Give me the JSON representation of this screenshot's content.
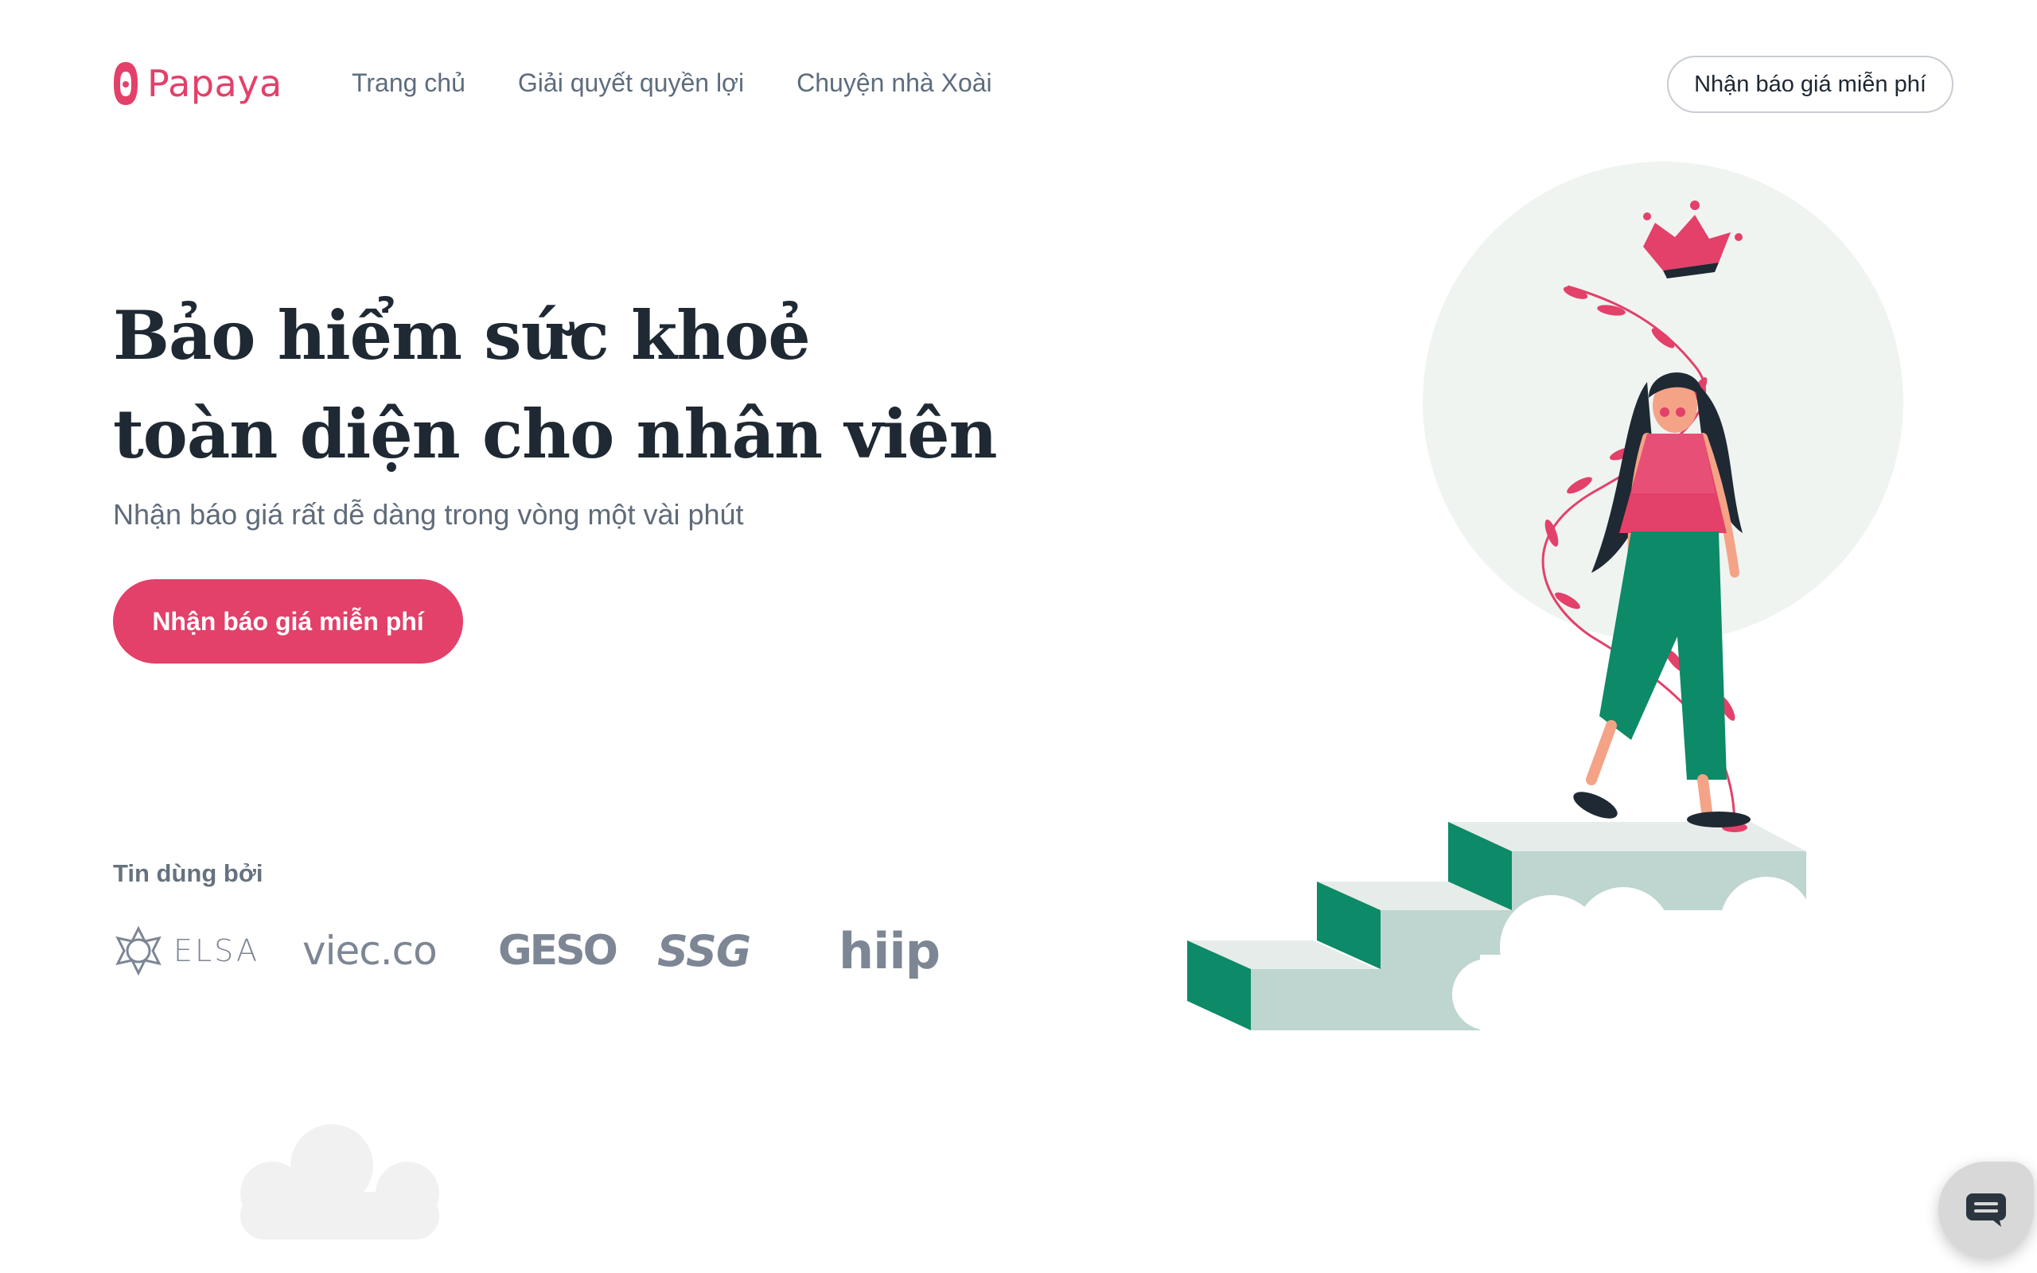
{
  "theme": {
    "brand": "#e3406a",
    "navy": "#1f2933",
    "muted": "#5f6b7a",
    "illustration_green": "#0d8a67",
    "illustration_circle": "#eff4f1"
  },
  "header": {
    "logo_text": "Papaya",
    "logo_icon": "papaya-logo-icon",
    "nav": [
      {
        "label": "Trang chủ"
      },
      {
        "label": "Giải quyết quyền lợi"
      },
      {
        "label": "Chuyện nhà Xoài"
      }
    ],
    "cta_label": "Nhận báo giá miễn phí"
  },
  "hero": {
    "title_line1": "Bảo hiểm sức khoẻ",
    "title_line2": "toàn diện cho nhân viên",
    "subtitle": "Nhận báo giá rất dễ dàng trong vòng một vài phút",
    "cta_label": "Nhận báo giá miễn phí"
  },
  "trusted": {
    "label": "Tin dùng bởi",
    "partners": [
      {
        "name": "ELSA",
        "text": "ELSA",
        "icon": "elsa-star-icon"
      },
      {
        "name": "viec.co",
        "text": "viec.co"
      },
      {
        "name": "GESO",
        "text": "GESO"
      },
      {
        "name": "SSG",
        "text": "SSG"
      },
      {
        "name": "hiip",
        "text": "hiip"
      }
    ]
  },
  "chat": {
    "icon": "chat-bubble-icon"
  }
}
